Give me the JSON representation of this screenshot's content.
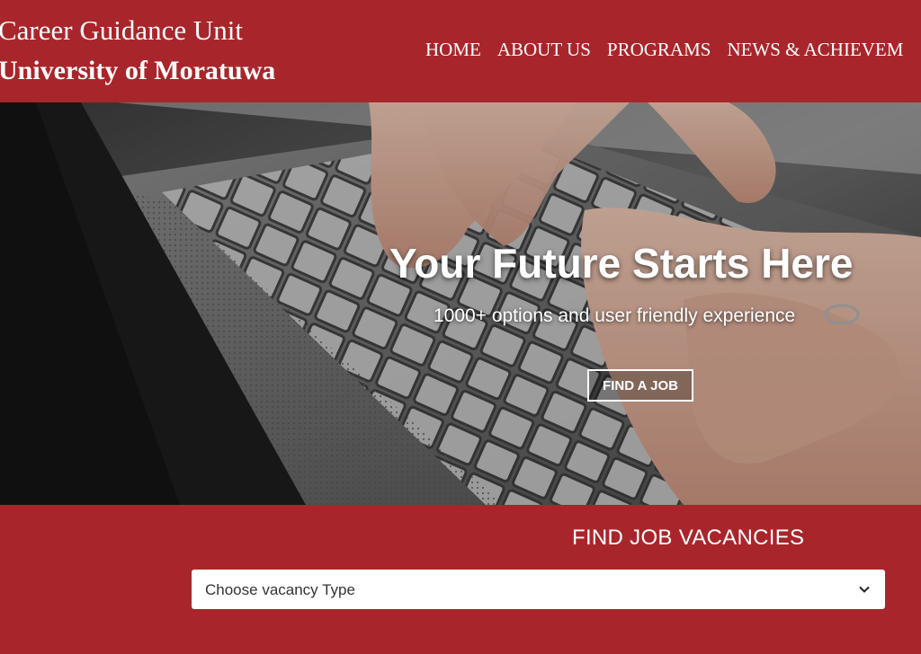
{
  "header": {
    "brand_line1": "Career Guidance Unit",
    "brand_line2": "University of Moratuwa"
  },
  "nav": {
    "items": [
      "HOME",
      "ABOUT US",
      "PROGRAMS",
      "NEWS & ACHIEVEM"
    ]
  },
  "hero": {
    "title": "Your Future Starts Here",
    "subtitle": "1000+ options and user friendly experience",
    "button_label": "FIND A JOB"
  },
  "vacancies": {
    "title": "FIND JOB VACANCIES",
    "select_value": "Choose vacancy Type",
    "select_icon": "chevron-down-icon"
  },
  "colors": {
    "brand_red": "#a8262b",
    "text_white": "#ffffff"
  }
}
